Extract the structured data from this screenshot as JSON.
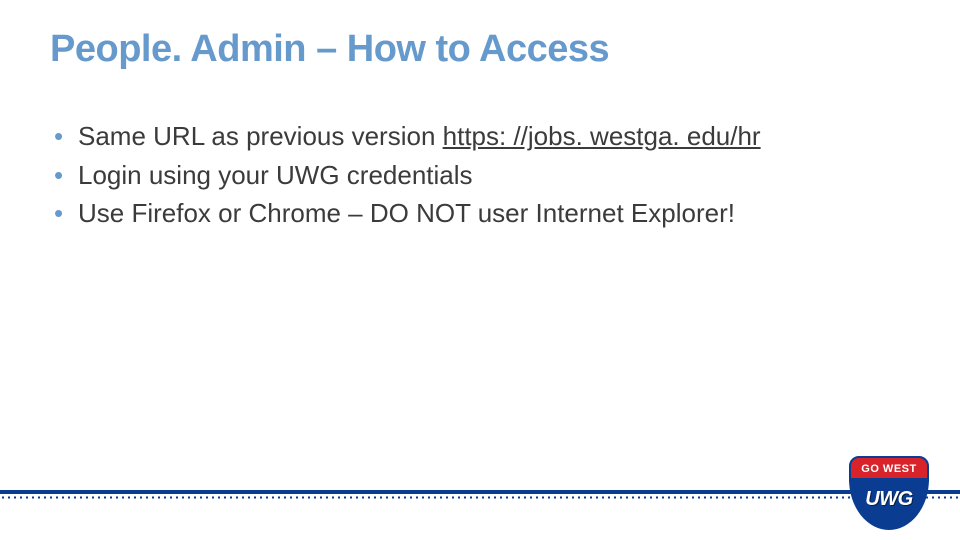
{
  "title": "People. Admin – How to Access",
  "bullets": [
    {
      "prefix": "Same URL as previous version ",
      "link_text": "https: //jobs. westga. edu/hr"
    },
    {
      "prefix": "Login using your UWG credentials",
      "link_text": ""
    },
    {
      "prefix": "Use Firefox or Chrome – DO NOT user Internet Explorer!",
      "link_text": ""
    }
  ],
  "logo": {
    "top_text": "GO WEST",
    "bottom_text": "UWG"
  },
  "colors": {
    "heading": "#6699cc",
    "bullet": "#6699cc",
    "body_text": "#3b3b3b",
    "rule": "#0a3d91",
    "logo_red": "#d8232a",
    "logo_blue": "#0a3d91"
  }
}
